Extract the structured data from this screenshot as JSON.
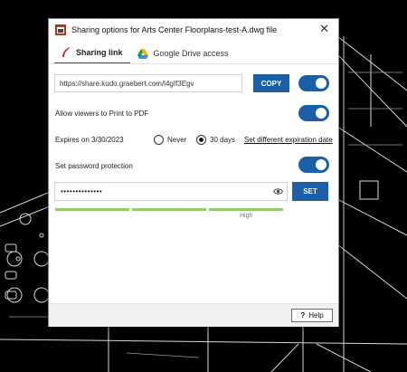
{
  "window": {
    "title": "Sharing options for Arts Center Floorplans-test-A.dwg file",
    "close_glyph": "✕"
  },
  "tabs": [
    {
      "label": "Sharing link",
      "icon": "kudo-feather-icon",
      "active": true
    },
    {
      "label": "Google Drive access",
      "icon": "google-drive-icon",
      "active": false
    }
  ],
  "link": {
    "url": "https://share.kudo.graebert.com/l4gIf3Egv",
    "copy_label": "COPY",
    "enabled": true
  },
  "print": {
    "label": "Allow viewers to Print to PDF",
    "enabled": true
  },
  "expiry": {
    "label": "Expires on 3/30/2023",
    "options": [
      "Never",
      "30 days"
    ],
    "selected": "30 days",
    "set_link": "Set different expiration date"
  },
  "password": {
    "label": "Set password protection",
    "enabled": true,
    "masked_value": "••••••••••••••",
    "set_label": "SET",
    "strength_label": "High",
    "strength_level": 1.0
  },
  "footer": {
    "help_label": "Help",
    "help_glyph": "?"
  },
  "colors": {
    "accent": "#1b5fa9",
    "strength": "#8fca6d"
  }
}
